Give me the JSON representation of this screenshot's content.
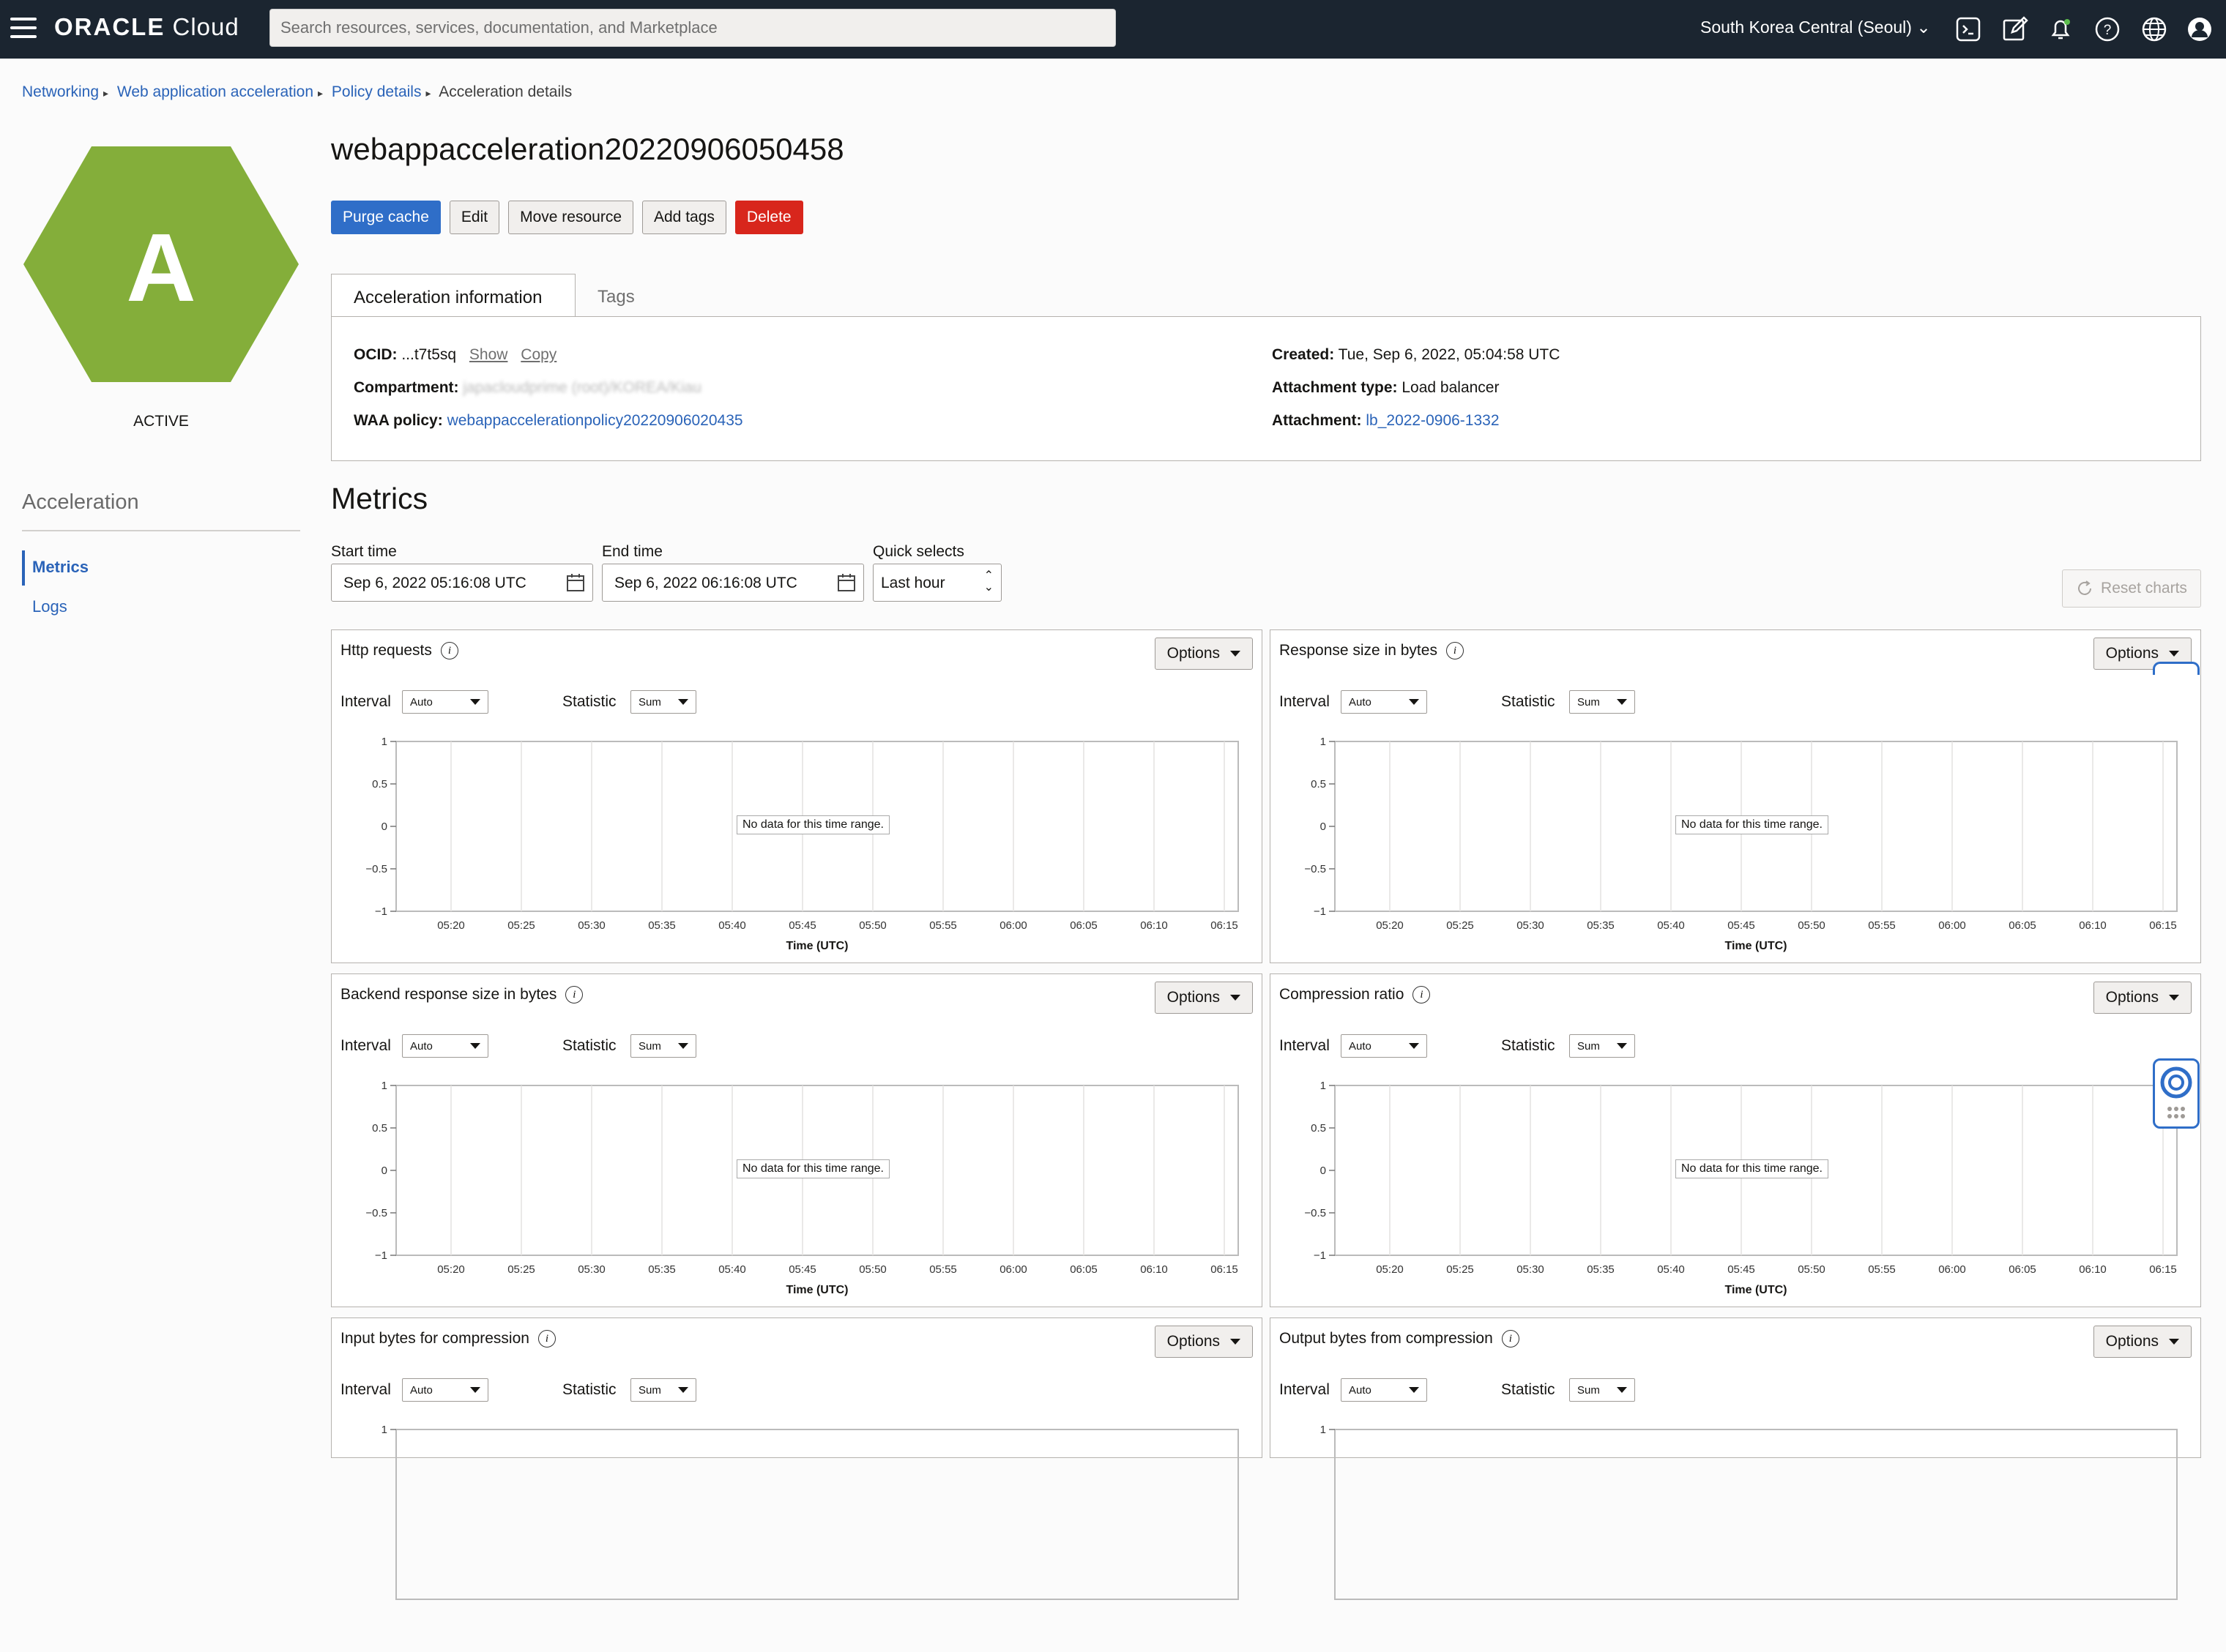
{
  "topbar": {
    "brand_bold": "ORACLE",
    "brand_light": " Cloud",
    "search_placeholder": "Search resources, services, documentation, and Marketplace",
    "region": "South Korea Central (Seoul)",
    "icons": [
      "cloud-shell-icon",
      "edit-icon",
      "notifications-icon",
      "help-icon",
      "language-icon",
      "profile-icon"
    ]
  },
  "breadcrumb": {
    "items": [
      "Networking",
      "Web application acceleration",
      "Policy details"
    ],
    "current": "Acceleration details"
  },
  "resource": {
    "badge_letter": "A",
    "badge_color": "#84ae3a",
    "status": "ACTIVE",
    "title": "webappacceleration20220906050458"
  },
  "actions": {
    "purge": "Purge cache",
    "edit": "Edit",
    "move": "Move resource",
    "tags": "Add tags",
    "delete": "Delete"
  },
  "tabs": [
    "Acceleration information",
    "Tags"
  ],
  "info": {
    "ocid_label": "OCID:",
    "ocid_value": "...t7t5sq",
    "show": "Show",
    "copy": "Copy",
    "compartment_label": "Compartment:",
    "compartment_value": "japacloudprime (root)/KOREA/Kiau",
    "waa_label": "WAA policy:",
    "waa_value": "webappaccelerationpolicy20220906020435",
    "created_label": "Created:",
    "created_value": "Tue, Sep 6, 2022, 05:04:58 UTC",
    "att_type_label": "Attachment type:",
    "att_type_value": "Load balancer",
    "attachment_label": "Attachment:",
    "attachment_value": "lb_2022-0906-1332"
  },
  "sidebar": {
    "heading": "Acceleration",
    "items": [
      "Metrics",
      "Logs"
    ]
  },
  "metrics": {
    "title": "Metrics",
    "start_label": "Start time",
    "start_value": "Sep 6, 2022 05:16:08 UTC",
    "end_label": "End time",
    "end_value": "Sep 6, 2022 06:16:08 UTC",
    "quick_label": "Quick selects",
    "quick_value": "Last hour",
    "reset": "Reset charts"
  },
  "chart_common": {
    "options": "Options",
    "interval_label": "Interval",
    "interval_value": "Auto",
    "statistic_label": "Statistic",
    "statistic_value": "Sum",
    "nodata": "No data for this time range.",
    "xlabel": "Time (UTC)"
  },
  "chart_data": [
    {
      "type": "line",
      "title": "Http requests",
      "xlabel": "Time (UTC)",
      "ylabel": "",
      "x_ticks": [
        "05:20",
        "05:25",
        "05:30",
        "05:35",
        "05:40",
        "05:45",
        "05:50",
        "05:55",
        "06:00",
        "06:05",
        "06:10",
        "06:15"
      ],
      "y_ticks": [
        "1",
        "0.5",
        "0",
        "−0.5",
        "−1"
      ],
      "ylim": [
        -1,
        1
      ],
      "series": []
    },
    {
      "type": "line",
      "title": "Response size in bytes",
      "xlabel": "Time (UTC)",
      "ylabel": "",
      "x_ticks": [
        "05:20",
        "05:25",
        "05:30",
        "05:35",
        "05:40",
        "05:45",
        "05:50",
        "05:55",
        "06:00",
        "06:05",
        "06:10",
        "06:15"
      ],
      "y_ticks": [
        "1",
        "0.5",
        "0",
        "−0.5",
        "−1"
      ],
      "ylim": [
        -1,
        1
      ],
      "series": []
    },
    {
      "type": "line",
      "title": "Backend response size in bytes",
      "xlabel": "Time (UTC)",
      "ylabel": "",
      "x_ticks": [
        "05:20",
        "05:25",
        "05:30",
        "05:35",
        "05:40",
        "05:45",
        "05:50",
        "05:55",
        "06:00",
        "06:05",
        "06:10",
        "06:15"
      ],
      "y_ticks": [
        "1",
        "0.5",
        "0",
        "−0.5",
        "−1"
      ],
      "ylim": [
        -1,
        1
      ],
      "series": []
    },
    {
      "type": "line",
      "title": "Compression ratio",
      "xlabel": "Time (UTC)",
      "ylabel": "",
      "x_ticks": [
        "05:20",
        "05:25",
        "05:30",
        "05:35",
        "05:40",
        "05:45",
        "05:50",
        "05:55",
        "06:00",
        "06:05",
        "06:10",
        "06:15"
      ],
      "y_ticks": [
        "1",
        "0.5",
        "0",
        "−0.5",
        "−1"
      ],
      "ylim": [
        -1,
        1
      ],
      "series": []
    },
    {
      "type": "line",
      "title": "Input bytes for compression",
      "xlabel": "",
      "ylabel": "",
      "x_ticks": [],
      "y_ticks": [
        "1"
      ],
      "ylim": [
        -1,
        1
      ],
      "series": []
    },
    {
      "type": "line",
      "title": "Output bytes from compression",
      "xlabel": "",
      "ylabel": "",
      "x_ticks": [],
      "y_ticks": [
        "1"
      ],
      "ylim": [
        -1,
        1
      ],
      "series": []
    }
  ]
}
